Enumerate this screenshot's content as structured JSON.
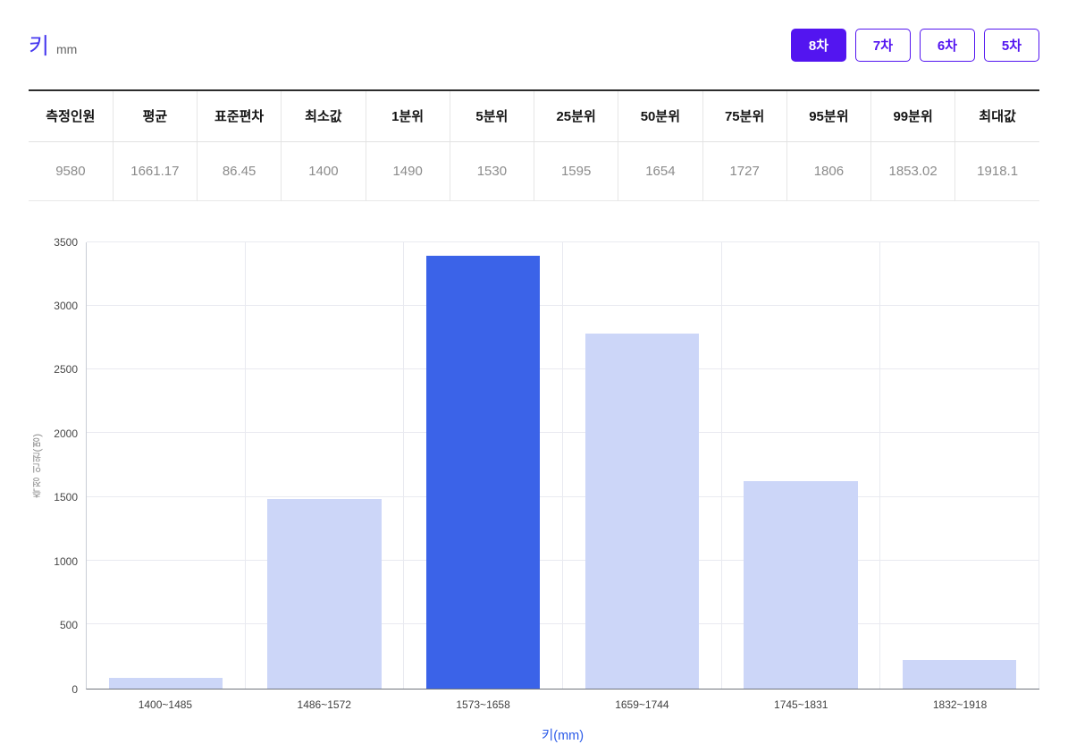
{
  "header": {
    "title": "키",
    "unit": "mm",
    "title_color": "#4638ef",
    "accent_color": "#5315f0",
    "tabs": [
      {
        "label": "8차",
        "active": true
      },
      {
        "label": "7차",
        "active": false
      },
      {
        "label": "6차",
        "active": false
      },
      {
        "label": "5차",
        "active": false
      }
    ]
  },
  "stats_table": {
    "headers": [
      "측정인원",
      "평균",
      "표준편차",
      "최소값",
      "1분위",
      "5분위",
      "25분위",
      "50분위",
      "75분위",
      "95분위",
      "99분위",
      "최대값"
    ],
    "values": [
      "9580",
      "1661.17",
      "86.45",
      "1400",
      "1490",
      "1530",
      "1595",
      "1654",
      "1727",
      "1806",
      "1853.02",
      "1918.1"
    ]
  },
  "chart_data": {
    "type": "bar",
    "title": "",
    "categories": [
      "1400~1485",
      "1486~1572",
      "1573~1658",
      "1659~1744",
      "1745~1831",
      "1832~1918"
    ],
    "values": [
      80,
      1485,
      3390,
      2780,
      1625,
      220
    ],
    "highlight_index": 2,
    "highlight_category": "1573~1658",
    "xlabel": "키(mm)",
    "ylabel": "측정 인원(명)",
    "ylim": [
      0,
      3500
    ],
    "ytick_step": 500,
    "grid": true,
    "legend": "none",
    "colors": {
      "bar": "#ccd6f8",
      "bar_highlight": "#3b63e8",
      "xlabel": "#2a5ae8",
      "gridline": "#e9eaf0"
    }
  }
}
